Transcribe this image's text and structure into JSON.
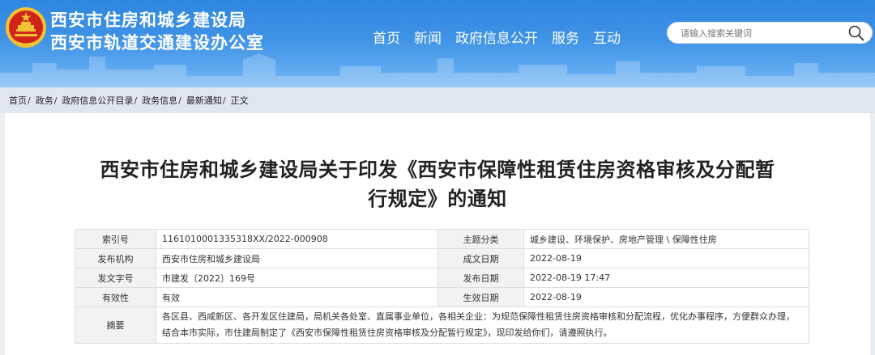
{
  "header": {
    "org_line1": "西安市住房和城乡建设局",
    "org_line2": "西安市轨道交通建设办公室",
    "nav": [
      "首页",
      "新闻",
      "政府信息公开",
      "服务",
      "互动"
    ],
    "search_placeholder": "请输入搜索关键词",
    "colors": {
      "header_blue": "#2f86df",
      "emblem_red": "#d0231c",
      "emblem_gold": "#f2c230"
    }
  },
  "breadcrumb": [
    "首页",
    "政务",
    "政府信息公开目录",
    "政务信息",
    "最新通知",
    "正文"
  ],
  "breadcrumb_sep": "/",
  "article": {
    "title_line1": "西安市住房和城乡建设局关于印发《西安市保障性租赁住房资格审核及分配暂",
    "title_line2": "行规定》的通知"
  },
  "info": {
    "index_label": "索引号",
    "index_value": "1161010001335318XX/2022-000908",
    "topic_label": "主题分类",
    "topic_value": "城乡建设、环境保护、房地产管理 \\ 保障性住房",
    "issuer_label": "发布机构",
    "issuer_value": "西安市住房和城乡建设局",
    "created_label": "成文日期",
    "created_value": "2022-08-19",
    "docno_label": "发文字号",
    "docno_value": "市建发〔2022〕169号",
    "published_label": "发布日期",
    "published_value": "2022-08-19 17:47",
    "validity_label": "有效性",
    "validity_value": "有效",
    "effective_label": "生效日期",
    "effective_value": "2022-08-19",
    "abstract_label": "摘要",
    "abstract_value": "各区县、西咸新区、各开发区住建局，局机关各处室、直属事业单位，各相关企业：为规范保障性租赁住房资格审核和分配流程，优化办事程序，方便群众办理，结合本市实际，市住建局制定了《西安市保障性租赁住房资格审核及分配暂行规定》，现印发给你们，请遵照执行。"
  }
}
